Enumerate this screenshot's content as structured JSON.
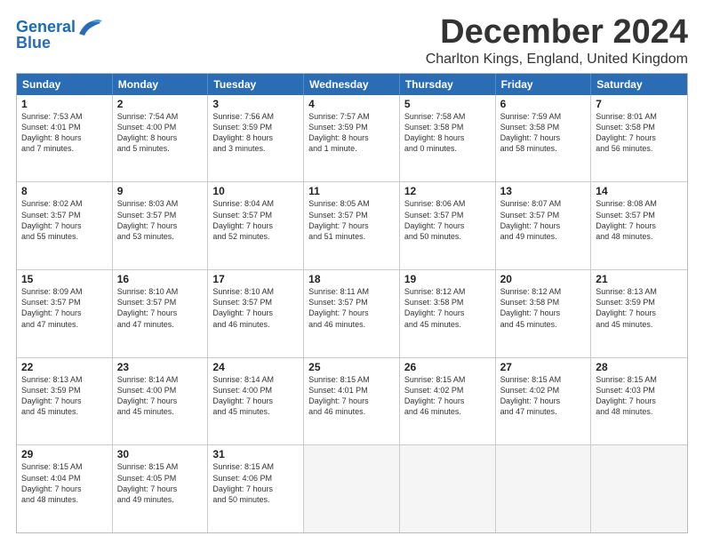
{
  "logo": {
    "line1": "General",
    "line2": "Blue"
  },
  "title": "December 2024",
  "subtitle": "Charlton Kings, England, United Kingdom",
  "header_days": [
    "Sunday",
    "Monday",
    "Tuesday",
    "Wednesday",
    "Thursday",
    "Friday",
    "Saturday"
  ],
  "weeks": [
    [
      {
        "day": "1",
        "lines": [
          "Sunrise: 7:53 AM",
          "Sunset: 4:01 PM",
          "Daylight: 8 hours",
          "and 7 minutes."
        ]
      },
      {
        "day": "2",
        "lines": [
          "Sunrise: 7:54 AM",
          "Sunset: 4:00 PM",
          "Daylight: 8 hours",
          "and 5 minutes."
        ]
      },
      {
        "day": "3",
        "lines": [
          "Sunrise: 7:56 AM",
          "Sunset: 3:59 PM",
          "Daylight: 8 hours",
          "and 3 minutes."
        ]
      },
      {
        "day": "4",
        "lines": [
          "Sunrise: 7:57 AM",
          "Sunset: 3:59 PM",
          "Daylight: 8 hours",
          "and 1 minute."
        ]
      },
      {
        "day": "5",
        "lines": [
          "Sunrise: 7:58 AM",
          "Sunset: 3:58 PM",
          "Daylight: 8 hours",
          "and 0 minutes."
        ]
      },
      {
        "day": "6",
        "lines": [
          "Sunrise: 7:59 AM",
          "Sunset: 3:58 PM",
          "Daylight: 7 hours",
          "and 58 minutes."
        ]
      },
      {
        "day": "7",
        "lines": [
          "Sunrise: 8:01 AM",
          "Sunset: 3:58 PM",
          "Daylight: 7 hours",
          "and 56 minutes."
        ]
      }
    ],
    [
      {
        "day": "8",
        "lines": [
          "Sunrise: 8:02 AM",
          "Sunset: 3:57 PM",
          "Daylight: 7 hours",
          "and 55 minutes."
        ]
      },
      {
        "day": "9",
        "lines": [
          "Sunrise: 8:03 AM",
          "Sunset: 3:57 PM",
          "Daylight: 7 hours",
          "and 53 minutes."
        ]
      },
      {
        "day": "10",
        "lines": [
          "Sunrise: 8:04 AM",
          "Sunset: 3:57 PM",
          "Daylight: 7 hours",
          "and 52 minutes."
        ]
      },
      {
        "day": "11",
        "lines": [
          "Sunrise: 8:05 AM",
          "Sunset: 3:57 PM",
          "Daylight: 7 hours",
          "and 51 minutes."
        ]
      },
      {
        "day": "12",
        "lines": [
          "Sunrise: 8:06 AM",
          "Sunset: 3:57 PM",
          "Daylight: 7 hours",
          "and 50 minutes."
        ]
      },
      {
        "day": "13",
        "lines": [
          "Sunrise: 8:07 AM",
          "Sunset: 3:57 PM",
          "Daylight: 7 hours",
          "and 49 minutes."
        ]
      },
      {
        "day": "14",
        "lines": [
          "Sunrise: 8:08 AM",
          "Sunset: 3:57 PM",
          "Daylight: 7 hours",
          "and 48 minutes."
        ]
      }
    ],
    [
      {
        "day": "15",
        "lines": [
          "Sunrise: 8:09 AM",
          "Sunset: 3:57 PM",
          "Daylight: 7 hours",
          "and 47 minutes."
        ]
      },
      {
        "day": "16",
        "lines": [
          "Sunrise: 8:10 AM",
          "Sunset: 3:57 PM",
          "Daylight: 7 hours",
          "and 47 minutes."
        ]
      },
      {
        "day": "17",
        "lines": [
          "Sunrise: 8:10 AM",
          "Sunset: 3:57 PM",
          "Daylight: 7 hours",
          "and 46 minutes."
        ]
      },
      {
        "day": "18",
        "lines": [
          "Sunrise: 8:11 AM",
          "Sunset: 3:57 PM",
          "Daylight: 7 hours",
          "and 46 minutes."
        ]
      },
      {
        "day": "19",
        "lines": [
          "Sunrise: 8:12 AM",
          "Sunset: 3:58 PM",
          "Daylight: 7 hours",
          "and 45 minutes."
        ]
      },
      {
        "day": "20",
        "lines": [
          "Sunrise: 8:12 AM",
          "Sunset: 3:58 PM",
          "Daylight: 7 hours",
          "and 45 minutes."
        ]
      },
      {
        "day": "21",
        "lines": [
          "Sunrise: 8:13 AM",
          "Sunset: 3:59 PM",
          "Daylight: 7 hours",
          "and 45 minutes."
        ]
      }
    ],
    [
      {
        "day": "22",
        "lines": [
          "Sunrise: 8:13 AM",
          "Sunset: 3:59 PM",
          "Daylight: 7 hours",
          "and 45 minutes."
        ]
      },
      {
        "day": "23",
        "lines": [
          "Sunrise: 8:14 AM",
          "Sunset: 4:00 PM",
          "Daylight: 7 hours",
          "and 45 minutes."
        ]
      },
      {
        "day": "24",
        "lines": [
          "Sunrise: 8:14 AM",
          "Sunset: 4:00 PM",
          "Daylight: 7 hours",
          "and 45 minutes."
        ]
      },
      {
        "day": "25",
        "lines": [
          "Sunrise: 8:15 AM",
          "Sunset: 4:01 PM",
          "Daylight: 7 hours",
          "and 46 minutes."
        ]
      },
      {
        "day": "26",
        "lines": [
          "Sunrise: 8:15 AM",
          "Sunset: 4:02 PM",
          "Daylight: 7 hours",
          "and 46 minutes."
        ]
      },
      {
        "day": "27",
        "lines": [
          "Sunrise: 8:15 AM",
          "Sunset: 4:02 PM",
          "Daylight: 7 hours",
          "and 47 minutes."
        ]
      },
      {
        "day": "28",
        "lines": [
          "Sunrise: 8:15 AM",
          "Sunset: 4:03 PM",
          "Daylight: 7 hours",
          "and 48 minutes."
        ]
      }
    ],
    [
      {
        "day": "29",
        "lines": [
          "Sunrise: 8:15 AM",
          "Sunset: 4:04 PM",
          "Daylight: 7 hours",
          "and 48 minutes."
        ]
      },
      {
        "day": "30",
        "lines": [
          "Sunrise: 8:15 AM",
          "Sunset: 4:05 PM",
          "Daylight: 7 hours",
          "and 49 minutes."
        ]
      },
      {
        "day": "31",
        "lines": [
          "Sunrise: 8:15 AM",
          "Sunset: 4:06 PM",
          "Daylight: 7 hours",
          "and 50 minutes."
        ]
      },
      {
        "day": "",
        "lines": []
      },
      {
        "day": "",
        "lines": []
      },
      {
        "day": "",
        "lines": []
      },
      {
        "day": "",
        "lines": []
      }
    ]
  ]
}
